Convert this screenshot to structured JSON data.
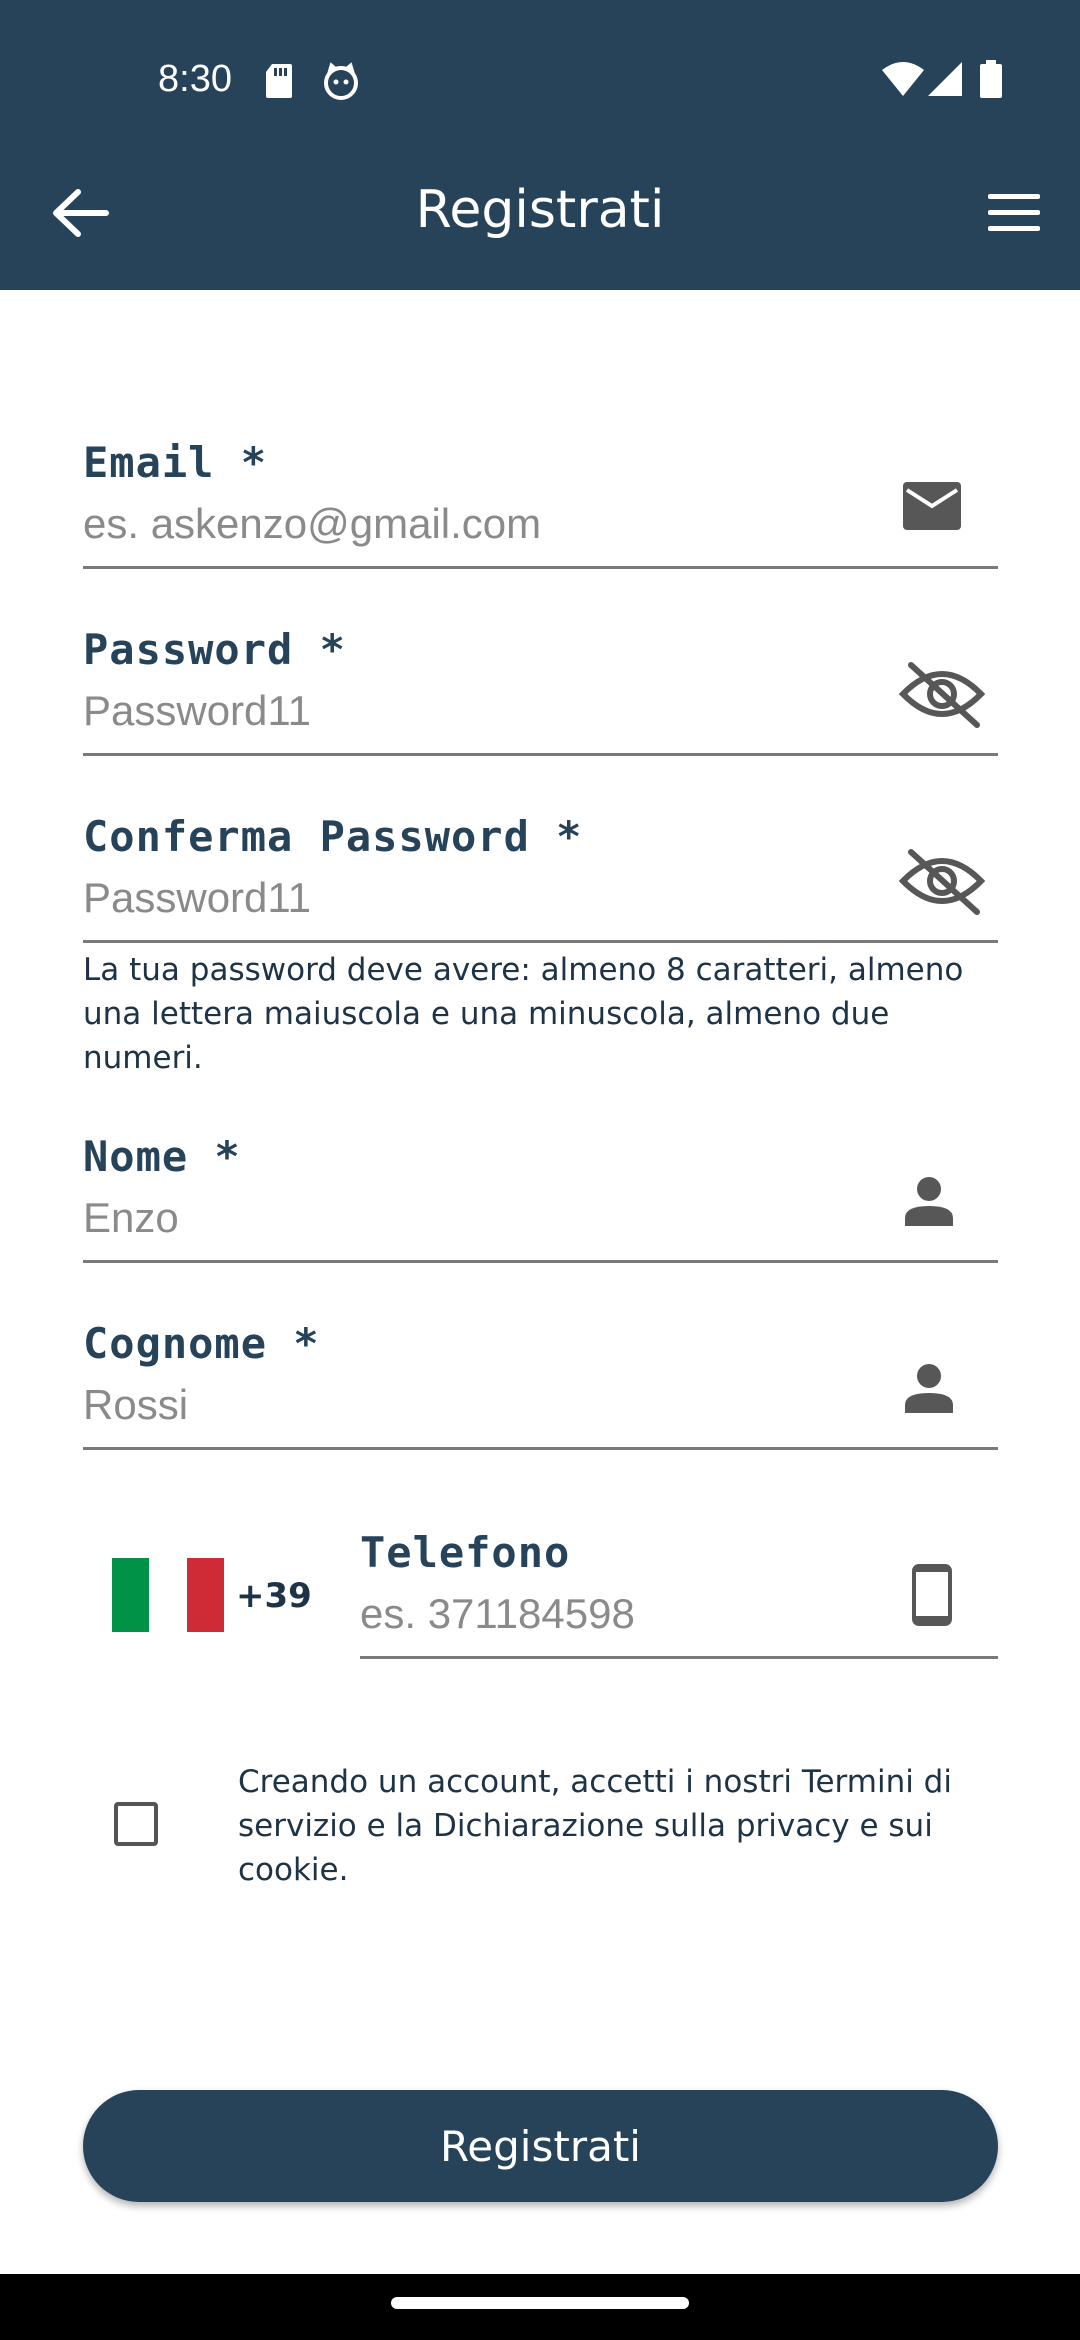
{
  "status_bar": {
    "time": "8:30",
    "icons": [
      "sd-card-icon",
      "cat-notification-icon",
      "wifi-icon",
      "signal-icon",
      "battery-icon"
    ]
  },
  "app_bar": {
    "title": "Registrati",
    "back_icon": "arrow-back-icon",
    "menu_icon": "hamburger-menu-icon"
  },
  "form": {
    "email": {
      "label": "Email *",
      "placeholder": "es. askenzo@gmail.com",
      "icon": "mail-icon"
    },
    "password": {
      "label": "Password *",
      "placeholder": "Password11",
      "icon": "eye-off-icon"
    },
    "confirm_password": {
      "label": "Conferma Password *",
      "placeholder": "Password11",
      "icon": "eye-off-icon"
    },
    "password_hint": "La tua password deve avere: almeno 8 caratteri, almeno una lettera maiuscola e una minuscola, almeno due numeri.",
    "first_name": {
      "label": "Nome *",
      "placeholder": "Enzo",
      "icon": "person-icon"
    },
    "last_name": {
      "label": "Cognome *",
      "placeholder": "Rossi",
      "icon": "person-icon"
    },
    "phone": {
      "country_flag": "italy-flag-icon",
      "dial_code": "+39",
      "label": "Telefono",
      "placeholder": "es. 371184598",
      "icon": "smartphone-icon"
    },
    "terms": {
      "checked": false,
      "text": "Creando un account, accetti i nostri Termini di servizio e la Dichiarazione sulla privacy e sui cookie."
    },
    "submit_label": "Registrati"
  },
  "colors": {
    "primary": "#27435a",
    "label": "#27435a",
    "placeholder": "#8a8a8a",
    "flag_green": "#009246",
    "flag_red": "#ce2b37"
  }
}
